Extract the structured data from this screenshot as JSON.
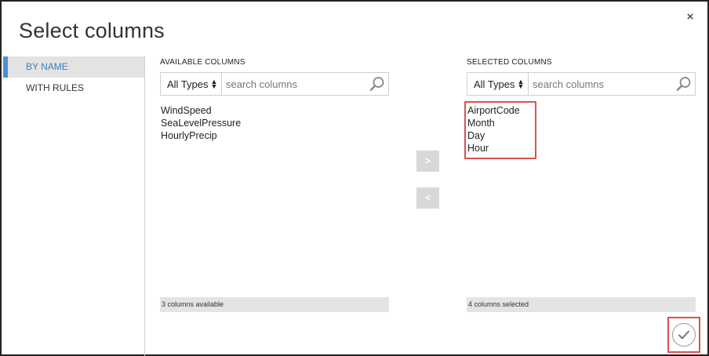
{
  "dialog": {
    "title": "Select columns",
    "close_label": "×",
    "ok_icon": "checkmark-icon"
  },
  "sidebar": {
    "items": [
      {
        "label": "BY NAME",
        "active": true
      },
      {
        "label": "WITH RULES",
        "active": false
      }
    ]
  },
  "available": {
    "header": "AVAILABLE COLUMNS",
    "type_filter": "All Types",
    "search_placeholder": "search columns",
    "columns": [
      "WindSpeed",
      "SeaLevelPressure",
      "HourlyPrecip"
    ],
    "status": "3 columns available"
  },
  "selected": {
    "header": "SELECTED COLUMNS",
    "type_filter": "All Types",
    "search_placeholder": "search columns",
    "columns": [
      "AirportCode",
      "Month",
      "Day",
      "Hour"
    ],
    "status": "4 columns selected"
  },
  "move": {
    "add_label": ">",
    "remove_label": "<"
  },
  "colors": {
    "accent": "#4a90d2",
    "highlight": "#d9534f"
  }
}
